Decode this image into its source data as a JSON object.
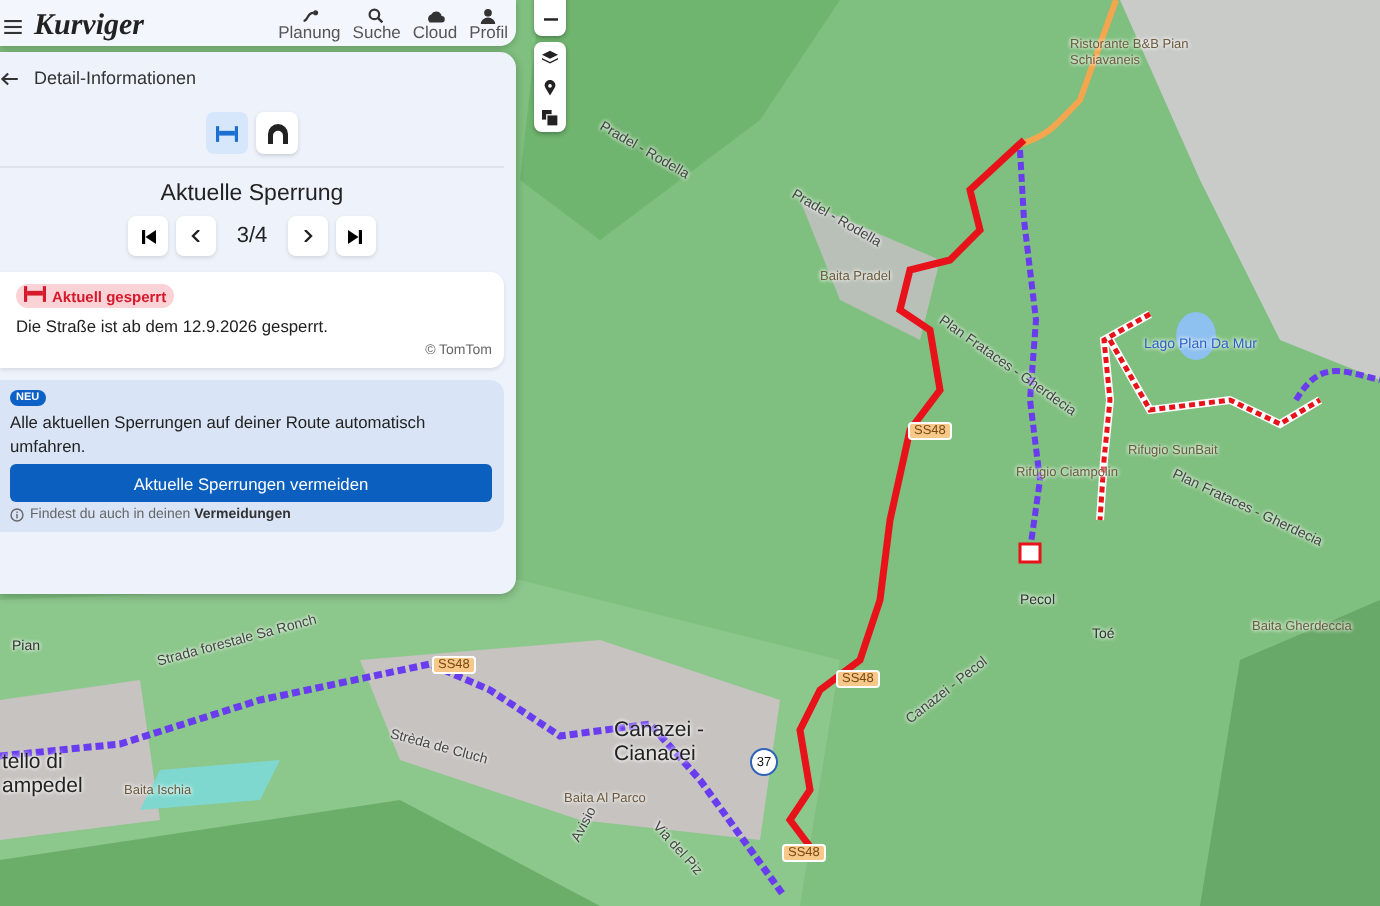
{
  "header": {
    "logo": "Kurviger",
    "nav": [
      {
        "label": "Planung",
        "kind": "route"
      },
      {
        "label": "Suche",
        "kind": "search"
      },
      {
        "label": "Cloud",
        "kind": "cloud"
      },
      {
        "label": "Profil",
        "kind": "user"
      }
    ]
  },
  "panel": {
    "title": "Detail-Informationen",
    "modes": [
      {
        "kind": "barrier",
        "selected": true
      },
      {
        "kind": "tunnel",
        "selected": false
      }
    ],
    "heading": "Aktuelle Sperrung",
    "pager": {
      "position": "3/4"
    },
    "closure": {
      "badge": "Aktuell gesperrt",
      "text": "Die Straße ist ab dem 12.9.2026 gesperrt.",
      "source": "© TomTom"
    },
    "promo": {
      "badge": "NEU",
      "text": "Alle aktuellen Sperrungen auf deiner Route automatisch umfahren.",
      "button": "Aktuelle Sperrungen vermeiden",
      "hint": "Findest du auch in deinen **Vermeidungen**"
    }
  },
  "map": {
    "labels": [
      {
        "text": "Ristorante B&B Pian Schiavaneis",
        "kind": "poi"
      },
      {
        "text": "Pradel - Rodella",
        "kind": "road"
      },
      {
        "text": "Pradel - Rodella",
        "kind": "road"
      },
      {
        "text": "Baita Pradel",
        "kind": "poi"
      },
      {
        "text": "Plan Frataces - Gherdecia",
        "kind": "road"
      },
      {
        "text": "Lago Plan Da Mur",
        "kind": "water"
      },
      {
        "text": "Plan Frataces - Gherdecia",
        "kind": "road"
      },
      {
        "text": "Rifugio SunBait",
        "kind": "poi"
      },
      {
        "text": "Rifugio Ciampolin",
        "kind": "poi"
      },
      {
        "text": "Pecol",
        "kind": "place"
      },
      {
        "text": "Toé",
        "kind": "place"
      },
      {
        "text": "Baita Gherdeccia",
        "kind": "poi"
      },
      {
        "text": "Canazei - Pecol",
        "kind": "road"
      },
      {
        "text": "Canazei - Cianacei",
        "kind": "town"
      },
      {
        "text": "Strèda de Cluch",
        "kind": "road"
      },
      {
        "text": "Baita Al Parco",
        "kind": "poi"
      },
      {
        "text": "Via del Piz",
        "kind": "road"
      },
      {
        "text": "Avisio",
        "kind": "road"
      },
      {
        "text": "Strada forestale Sa Ronch",
        "kind": "road"
      },
      {
        "text": "Pian",
        "kind": "place"
      },
      {
        "text": "tello di ampedel",
        "kind": "town"
      },
      {
        "text": "Baita Ischia",
        "kind": "poi"
      },
      {
        "text": "SS48",
        "kind": "shield"
      },
      {
        "text": "SS48",
        "kind": "shield"
      },
      {
        "text": "SS48",
        "kind": "shield"
      },
      {
        "text": "SS48",
        "kind": "shield"
      },
      {
        "text": "37",
        "kind": "marker"
      }
    ]
  }
}
